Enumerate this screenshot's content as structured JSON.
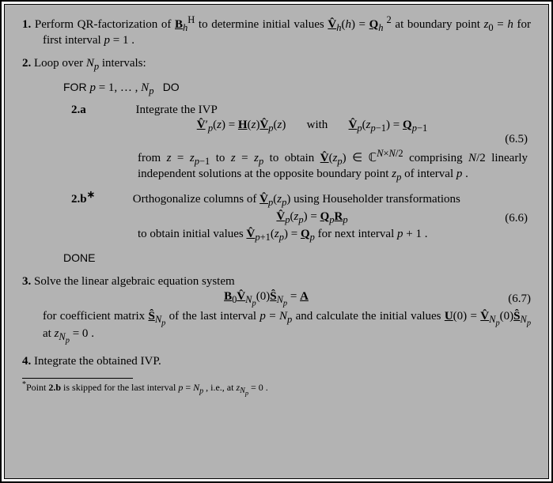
{
  "step1": {
    "num": "1.",
    "text_a": "Perform QR-factorization of ",
    "math_a": "B͟ₕᴴ",
    "text_b": " to determine initial values ",
    "math_b": "V̂͟ₕ(h) = Q͟ₕ²",
    "text_c": " at boundary point ",
    "math_c": "z₀ = h",
    "text_d": " for first interval ",
    "math_d": "p = 1",
    "text_e": " ."
  },
  "step2": {
    "num": "2.",
    "text": "Loop over ",
    "math": "Nₚ",
    "text_b": " intervals:"
  },
  "for": {
    "kw1": "FOR ",
    "expr": " p = 1, … , Nₚ  ",
    "kw2": "DO"
  },
  "sub2a": {
    "label": "2.a",
    "text": "Integrate the IVP",
    "eq_lhs": "V̂͟′ₚ(z) = H͟(z)V̂͟ₚ(z)",
    "eq_with": "with",
    "eq_rhs": "V̂͟ₚ(zₚ₋₁) = Q͟ₚ₋₁",
    "eq_num": "(6.5)",
    "after_a": "from ",
    "m1": "z = zₚ₋₁",
    "after_b": " to ",
    "m2": "z = zₚ",
    "after_c": " to obtain ",
    "m3": "V̂͟(zₚ) ∈ ℂᴺˣᴺ/²",
    "after_d": " comprising ",
    "m4": "N/2",
    "after_e": " linearly independent solutions at the opposite boundary point ",
    "m5": "zₚ",
    "after_f": " of interval ",
    "m6": "p",
    "after_g": " ."
  },
  "sub2b": {
    "label": "2.b*",
    "text_a": "Orthogonalize columns of ",
    "m1": "V̂͟ₚ(zₚ)",
    "text_b": " using Householder transformations",
    "eq": "V̂͟ₚ(zₚ) = Q͟ₚR͟ₚ",
    "eq_num": "(6.6)",
    "after_a": "to obtain initial values ",
    "m2": "V̂͟ₚ₊₁(zₚ) = Q͟ₚ",
    "after_b": " for next interval ",
    "m3": "p + 1",
    "after_c": " ."
  },
  "done": "DONE",
  "step3": {
    "num": "3.",
    "text": "Solve the linear algebraic equation system",
    "eq": "B͟₀V̂͟ₙₚ(0)Ŝ͟ₙₚ = A͟",
    "eq_num": "(6.7)",
    "after_a": "for coefficient matrix ",
    "m1": "Ŝ͟ₙₚ",
    "after_b": " of the last interval ",
    "m2": "p = Nₚ",
    "after_c": " and calculate the initial values ",
    "m3": "U͟(0) = V̂͟ₙₚ(0)Ŝ͟ₙₚ",
    "after_d": " at ",
    "m4": "zₙₚ = 0",
    "after_e": " ."
  },
  "step4": {
    "num": "4.",
    "text": "Integrate the obtained IVP."
  },
  "footnote": {
    "mark": "*",
    "a": "Point ",
    "b": "2.b",
    "c": " is skipped for the last interval ",
    "m1": "p = Nₚ",
    "d": " , i.e., at ",
    "m2": "zₙₚ = 0",
    "e": " ."
  }
}
